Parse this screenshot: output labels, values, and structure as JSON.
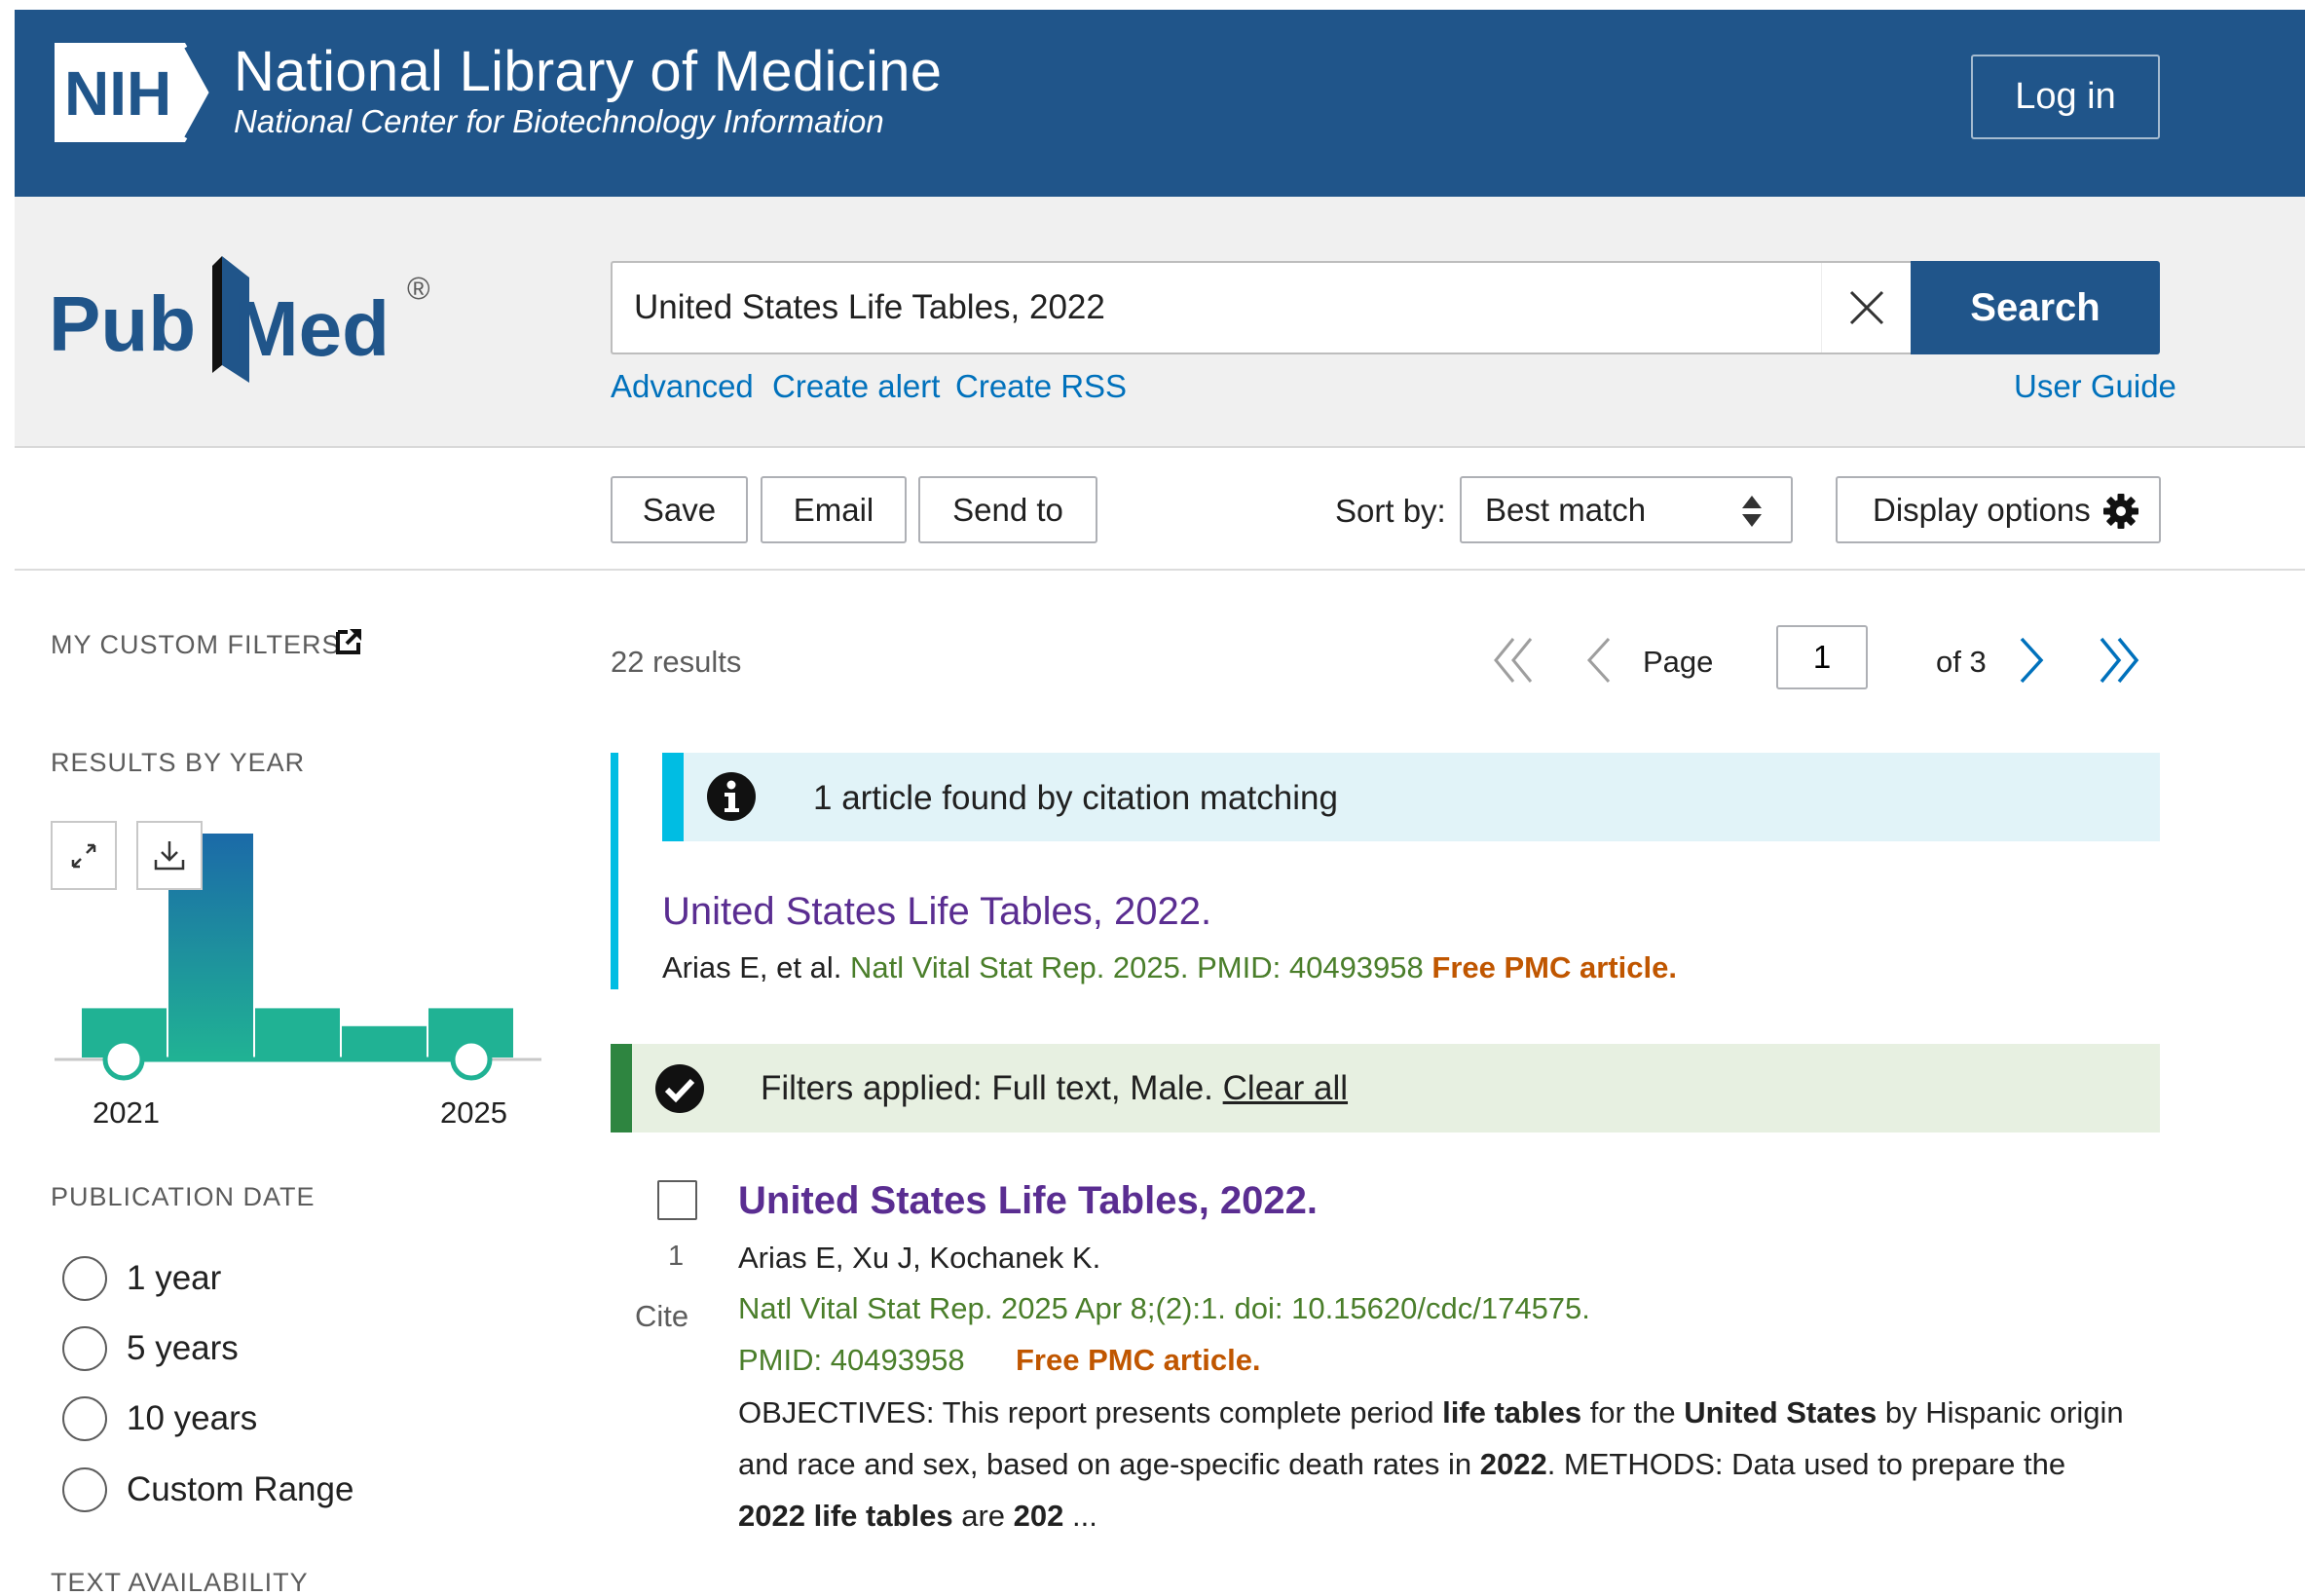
{
  "nih": {
    "logo_text": "NIH",
    "title": "National Library of Medicine",
    "subtitle": "National Center for Biotechnology Information",
    "login_label": "Log in"
  },
  "search": {
    "logo_text": "PubMed",
    "query": "United States Life Tables, 2022",
    "button_label": "Search",
    "links": {
      "advanced": "Advanced",
      "create_alert": "Create alert",
      "create_rss": "Create RSS",
      "user_guide": "User Guide"
    }
  },
  "toolbar": {
    "save_label": "Save",
    "email_label": "Email",
    "send_to_label": "Send to",
    "sort_label": "Sort by:",
    "sort_value": "Best match",
    "display_label": "Display options"
  },
  "sidebar": {
    "custom_filters": "MY CUSTOM FILTERS",
    "results_by_year": "RESULTS BY YEAR",
    "year_start": "2021",
    "year_end": "2025",
    "year_counts_relative": [
      0.22,
      1.0,
      0.22,
      0.14,
      0.22
    ],
    "publication_date": "PUBLICATION DATE",
    "date_options": [
      "1 year",
      "5 years",
      "10 years",
      "Custom Range"
    ],
    "text_availability": "TEXT AVAILABILITY"
  },
  "results": {
    "count_label": "22 results",
    "page_label": "Page",
    "page_value": "1",
    "of_label": "of 3",
    "citation_notice": "1 article found by citation matching",
    "citation": {
      "title": "United States Life Tables, 2022.",
      "authors": "Arias E, et al.",
      "journal": "Natl Vital Stat Rep. 2025. PMID: 40493958",
      "free": "Free PMC article."
    },
    "filters_label": "Filters applied: Full text, Male.",
    "clear_all": "Clear all",
    "item": {
      "number": "1",
      "cite": "Cite",
      "title": "United States Life Tables, 2022.",
      "authors": "Arias E, Xu J, Kochanek K.",
      "journal": "Natl Vital Stat Rep. 2025 Apr 8;(2):1. doi: 10.15620/cdc/174575.",
      "pmid": "PMID: 40493958",
      "free": "Free PMC article.",
      "snippet": {
        "p1": "OBJECTIVES: This report presents complete period ",
        "b1": "life tables",
        "p2": " for the ",
        "b2": "United States",
        "p3": " by Hispanic origin and race and sex, based on age-specific death rates in ",
        "b3": "2022",
        "p4": ". METHODS: Data used to prepare the ",
        "b4": "2022",
        "p5": " ",
        "b5": "life tables",
        "p6": " are ",
        "b6": "202",
        "p7": " ..."
      }
    }
  },
  "colors": {
    "nih_blue": "#20558a",
    "link_blue": "#0071bc",
    "title_purple": "#5a2d91",
    "journal_green": "#4a7e2a",
    "free_orange": "#c05600",
    "info_cyan": "#00bde3",
    "filter_green": "#2e8540"
  }
}
